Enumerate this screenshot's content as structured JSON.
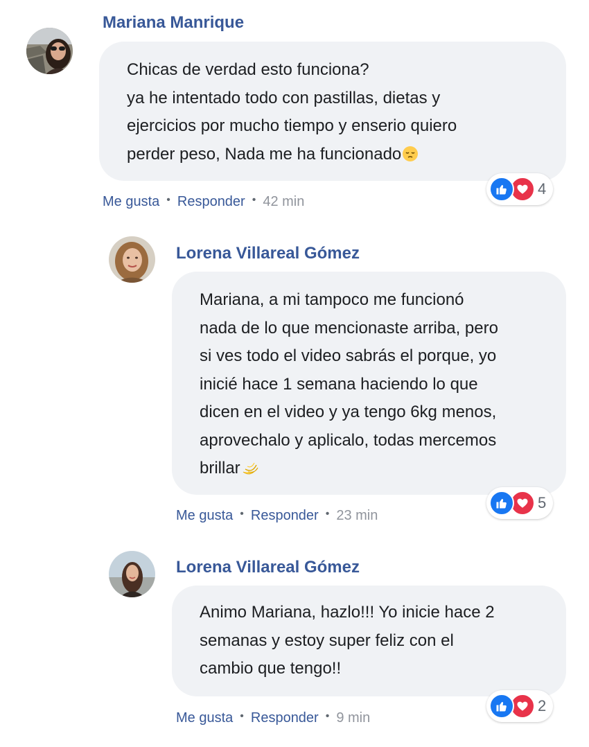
{
  "comments": [
    {
      "author": "Mariana Manrique",
      "lines": [
        "Chicas de verdad esto funciona?",
        "ya he intentado todo con pastillas, dietas y",
        "ejercicios por mucho tiempo y enserio quiero",
        "perder peso, Nada me ha funcionado"
      ],
      "emoji": "pensive-face",
      "like_label": "Me gusta",
      "reply_label": "Responder",
      "time": "42 min",
      "reaction_count": "4",
      "reaction_types": [
        "like",
        "love"
      ]
    },
    {
      "author": "Lorena Villareal Gómez",
      "lines": [
        "Mariana, a mi tampoco me funcionó",
        "nada de lo que mencionaste arriba, pero",
        "si ves todo el video sabrás el porque, yo",
        "inicié hace 1 semana haciendo lo que",
        "dicen en el video y ya tengo 6kg menos,",
        "aprovechalo y aplicalo, todas mercemos",
        "brillar"
      ],
      "emoji": "dizzy-star",
      "like_label": "Me gusta",
      "reply_label": "Responder",
      "time": "23 min",
      "reaction_count": "5",
      "reaction_types": [
        "like",
        "love"
      ]
    },
    {
      "author": "Lorena Villareal Gómez",
      "lines": [
        "Animo Mariana, hazlo!!! Yo inicie hace 2",
        "semanas y estoy super feliz con el",
        "cambio que tengo!!"
      ],
      "emoji": "",
      "like_label": "Me gusta",
      "reply_label": "Responder",
      "time": "9 min",
      "reaction_count": "2",
      "reaction_types": [
        "like",
        "love"
      ]
    }
  ],
  "colors": {
    "author": "#385898",
    "bubble": "#f0f2f5",
    "like": "#1877f2",
    "love": "#e8334a",
    "meta": "#90949c"
  }
}
